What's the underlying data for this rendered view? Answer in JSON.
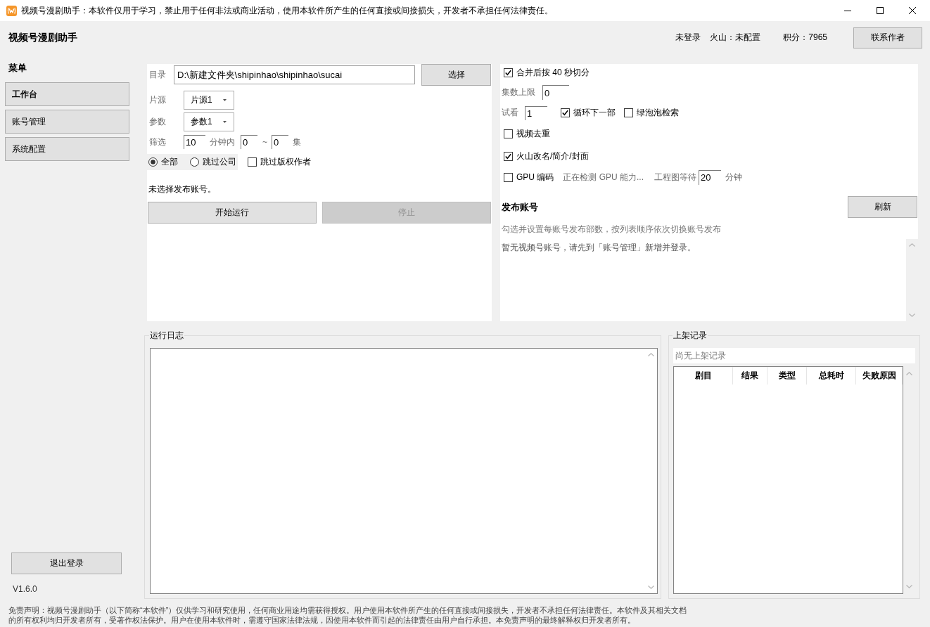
{
  "window": {
    "title": "视频号漫剧助手：本软件仅用于学习，禁止用于任何非法或商业活动，使用本软件所产生的任何直接或间接损失，开发者不承担任何法律责任。"
  },
  "header": {
    "app_name": "视频号漫剧助手",
    "login_status": "未登录",
    "volcano_status": "火山：未配置",
    "points": "积分：7965",
    "contact_button": "联系作者"
  },
  "sidebar": {
    "title": "菜单",
    "items": [
      {
        "label": "工作台",
        "selected": true
      },
      {
        "label": "账号管理",
        "selected": false
      },
      {
        "label": "系统配置",
        "selected": false
      }
    ],
    "logout_button": "退出登录",
    "version": "V1.6.0"
  },
  "task_panel": {
    "directory": {
      "label": "目录",
      "value": "D:\\新建文件夹\\shipinhao\\shipinhao\\sucai",
      "button": "选择"
    },
    "source": {
      "label": "片源",
      "value": "片源1"
    },
    "params": {
      "label": "参数",
      "value": "参数1"
    },
    "filter": {
      "label": "筛选",
      "minutes": "10",
      "minutes_unit": "分钟内",
      "from": "0",
      "separator": "~",
      "to": "0",
      "unit": "集"
    },
    "scope_options": [
      {
        "label": "全部",
        "selected": true
      },
      {
        "label": "跳过公司",
        "selected": false
      }
    ],
    "skip_copyright": {
      "label": "跳过版权作者",
      "checked": false
    },
    "account_status": "未选择发布账号。",
    "start_button": {
      "label": "开始运行",
      "disabled": false
    },
    "stop_button": {
      "label": "停止",
      "disabled": true
    }
  },
  "settings_panel": {
    "merge_split": {
      "label": "合并后按 40 秒切分",
      "checked": true
    },
    "episode_limit": {
      "label": "集数上限",
      "value": "0"
    },
    "preview": {
      "label": "试看",
      "value": "1"
    },
    "loop_next": {
      "label": "循环下一部",
      "checked": true
    },
    "green_bubble": {
      "label": "绿泡泡检索",
      "checked": false
    },
    "dedupe": {
      "label": "视频去重",
      "checked": false
    },
    "volcano_rename": {
      "label": "火山改名/简介/封面",
      "checked": true
    },
    "gpu_encode": {
      "label": "GPU 编码",
      "checked": false
    },
    "gpu_status": "正在检测 GPU 能力...",
    "project_wait": {
      "label": "工程图等待",
      "value": "20",
      "unit": "分钟"
    },
    "accounts": {
      "title": "发布账号",
      "refresh_button": "刷新",
      "hint": "勾选并设置每账号发布部数，按列表顺序依次切换账号发布",
      "empty_message": "暂无视频号账号，请先到「账号管理」新增并登录。"
    }
  },
  "log": {
    "title": "运行日志"
  },
  "records": {
    "title": "上架记录",
    "status": "尚无上架记录",
    "columns": [
      "剧目",
      "结果",
      "类型",
      "总耗时",
      "失败原因"
    ]
  },
  "footer": {
    "disclaimer": "免责声明：视频号漫剧助手（以下简称“本软件”）仅供学习和研究使用，任何商业用途均需获得授权。用户使用本软件所产生的任何直接或间接损失，开发者不承担任何法律责任。本软件及其相关文档的所有权利均归开发者所有，受著作权法保护。用户在使用本软件时，需遵守国家法律法规，因使用本软件而引起的法律责任由用户自行承担。本免责声明的最终解释权归开发者所有。"
  }
}
